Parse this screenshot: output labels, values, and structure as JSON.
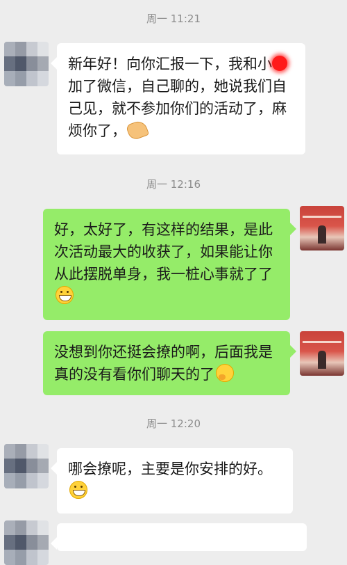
{
  "times": [
    "周一 11:21",
    "周一 12:16",
    "周一 12:20"
  ],
  "messages": [
    {
      "sender": "them",
      "text_pre": "新年好！向你汇报一下，我和小",
      "text_post": "加了微信，自己聊的，她说我们自己见，就不参加你们的活动了，麻烦你了，",
      "emoji": "ok-hand-icon"
    },
    {
      "sender": "me",
      "text": "好，太好了，有这样的结果，是此次活动最大的收获了，如果能让你从此摆脱单身，我一桩心事就了了",
      "emoji": "grin-icon"
    },
    {
      "sender": "me",
      "text": "没想到你还挺会撩的啊，后面我是真的没有看你们聊天的了",
      "emoji": "thinking-face-icon"
    },
    {
      "sender": "them",
      "text": "哪会撩呢，主要是你安排的好。",
      "emoji": "grin-icon"
    }
  ],
  "colors": {
    "background": "#ededed",
    "bubble_me": "#95ec69",
    "bubble_them": "#ffffff",
    "time_text": "#8c8c8c"
  }
}
